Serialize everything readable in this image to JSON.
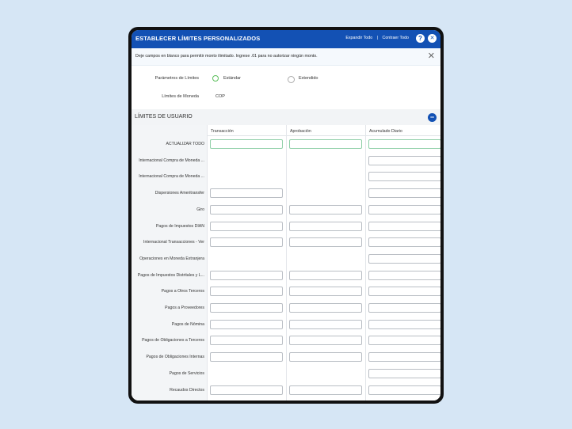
{
  "header": {
    "title": "ESTABLECER LÍMITES PERSONALIZADOS",
    "expand_label": "Expandir Todo",
    "separator": "|",
    "collapse_label": "Contraer Todo",
    "help_glyph": "?",
    "close_glyph": "✕"
  },
  "notice": {
    "text": "Deje campos en blanco para permitir monto ilimitado. Ingrese .01 para no autorizar ningún monto.",
    "close_glyph": "✕"
  },
  "params": {
    "limit_params_label": "Parámetros de Límites",
    "options": [
      {
        "label": "Estándar",
        "selected": true
      },
      {
        "label": "Extendido",
        "selected": false
      }
    ],
    "currency_label": "Límites de Moneda",
    "currency_value": "COP"
  },
  "section": {
    "title": "LÍMITES DE USUARIO",
    "toggle_glyph": "−"
  },
  "table": {
    "columns": [
      "Transacción",
      "Aprobación",
      "Acumulado Diario"
    ],
    "rows": [
      {
        "label": "ACTUALIZAR TODO",
        "fields": [
          true,
          true,
          true
        ]
      },
      {
        "label": "Internacional Compra de Moneda ...",
        "fields": [
          false,
          false,
          true
        ]
      },
      {
        "label": "Internacional Compra de Moneda ...",
        "fields": [
          false,
          false,
          true
        ]
      },
      {
        "label": "Dispersiones Ameritransfer",
        "fields": [
          true,
          false,
          true
        ]
      },
      {
        "label": "Giro",
        "fields": [
          true,
          true,
          true
        ]
      },
      {
        "label": "Pagos de Impuestos DIAN",
        "fields": [
          true,
          true,
          true
        ]
      },
      {
        "label": "Internacional Transacciones - Ver",
        "fields": [
          true,
          true,
          true
        ]
      },
      {
        "label": "Operaciones en Moneda Extranjera",
        "fields": [
          false,
          false,
          true
        ]
      },
      {
        "label": "Pagos de Impuestos Distritales y L...",
        "fields": [
          true,
          true,
          true
        ]
      },
      {
        "label": "Pagos a Otros Terceros",
        "fields": [
          true,
          true,
          true
        ]
      },
      {
        "label": "Pagos a Proveedores",
        "fields": [
          true,
          true,
          true
        ]
      },
      {
        "label": "Pagos de Nómina",
        "fields": [
          true,
          true,
          true
        ]
      },
      {
        "label": "Pagos de Obligaciones a Terceros",
        "fields": [
          true,
          true,
          true
        ]
      },
      {
        "label": "Pagos de Obligaciones Internas",
        "fields": [
          true,
          true,
          true
        ]
      },
      {
        "label": "Pagos de Servicios",
        "fields": [
          false,
          false,
          true
        ]
      },
      {
        "label": "Recaudos Directos",
        "fields": [
          true,
          true,
          true
        ]
      }
    ]
  },
  "colors": {
    "header_blue": "#1351b4",
    "radio_selected": "#5cbf5c",
    "highlight_input_border": "#8fcfa8"
  }
}
